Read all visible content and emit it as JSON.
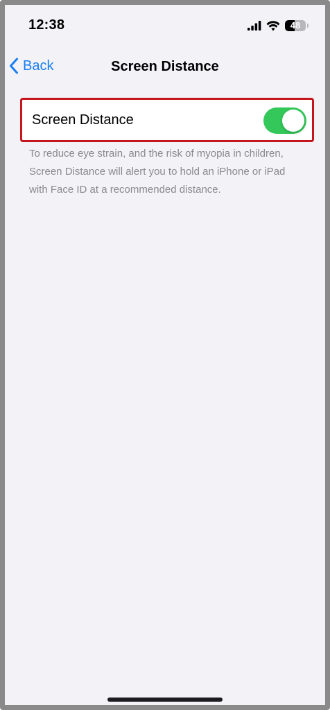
{
  "status_bar": {
    "time": "12:38",
    "battery_level": "48"
  },
  "nav": {
    "back_label": "Back",
    "title": "Screen Distance"
  },
  "setting": {
    "label": "Screen Distance",
    "enabled": true,
    "footer": "To reduce eye strain, and the risk of myopia in children, Screen Distance will alert you to hold an iPhone or iPad with Face ID at a recommended distance."
  },
  "colors": {
    "accent": "#1a7ef5",
    "toggle_on": "#34c759",
    "highlight_border": "#c5161d",
    "background": "#f2f2f7"
  },
  "icons": {
    "back": "chevron-left-icon",
    "signal": "cellular-signal-icon",
    "wifi": "wifi-icon",
    "battery": "battery-icon"
  }
}
